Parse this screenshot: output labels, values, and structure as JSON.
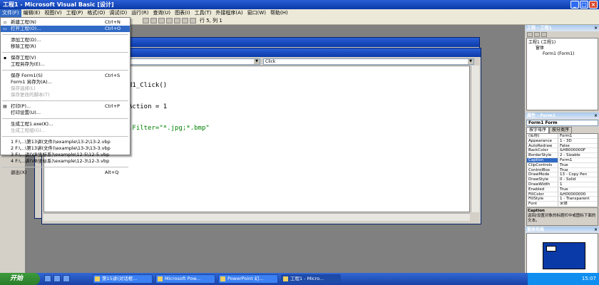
{
  "window": {
    "title": "工程1 - Microsoft Visual Basic [设计]",
    "min": "_",
    "max": "□",
    "close": "×"
  },
  "menubar": [
    "文件(F)",
    "编辑(E)",
    "视图(V)",
    "工程(P)",
    "格式(O)",
    "调试(D)",
    "运行(R)",
    "查询(U)",
    "图表(I)",
    "工具(T)",
    "外接程序(A)",
    "窗口(W)",
    "帮助(H)"
  ],
  "toolbar": {
    "position": "行 5, 列 1"
  },
  "file_menu": {
    "items": [
      {
        "label": "新建工程(N)",
        "shortcut": "Ctrl+N"
      },
      {
        "label": "打开工程(O)...",
        "shortcut": "Ctrl+O"
      },
      {
        "label": "添加工程(D)..."
      },
      {
        "label": "移除工程(R)"
      },
      {
        "label": "保存工程(V)"
      },
      {
        "label": "工程另存为(E)..."
      },
      {
        "label": "保存 Form1(S)",
        "shortcut": "Ctrl+S"
      },
      {
        "label": "Form1 另存为(A)..."
      },
      {
        "label": "保存选择(L)"
      },
      {
        "label": "保存更改的脚本(T)"
      },
      {
        "label": "打印(P)...",
        "shortcut": "Ctrl+P"
      },
      {
        "label": "打印设置(U)..."
      },
      {
        "label": "生成工程1.exe(K)..."
      },
      {
        "label": "生成工程组(G)..."
      },
      {
        "label": "1 F:\\...\\第13讲(文件)\\example\\13-2\\13-2.vbp"
      },
      {
        "label": "2 F:\\...\\第13讲(文件)\\example\\13-3\\13-3.vbp"
      },
      {
        "label": "3 F:\\...讲(VB坐标系)\\example\\12-5\\12-5.vbp"
      },
      {
        "label": "4 F:\\...讲(VB坐标系)\\example\\12-3\\12-3.vbp"
      },
      {
        "label": "退出(X)",
        "shortcut": "Alt+Q"
      }
    ]
  },
  "code_window": {
    "procedure_combo": "Click",
    "lines": [
      "d1_Click()",
      "Action = 1",
      ".Filter=\"*.jpg;*.bmp\""
    ]
  },
  "project_panel": {
    "title": "工程 - 工程1",
    "tree": [
      "工程1 (工程1)",
      "窗体",
      "Form1 (Form1)"
    ]
  },
  "properties_panel": {
    "title": "属性 - Form1",
    "object": "Form1 Form",
    "tabs": [
      "按字母序",
      "按分类序"
    ],
    "rows": [
      {
        "k": "(名称)",
        "v": "Form1"
      },
      {
        "k": "Appearance",
        "v": "1 - 3D"
      },
      {
        "k": "AutoRedraw",
        "v": "False"
      },
      {
        "k": "BackColor",
        "v": "&H8000000F"
      },
      {
        "k": "BorderStyle",
        "v": "2 - Sizable"
      },
      {
        "k": "Caption",
        "v": "Form1"
      },
      {
        "k": "ClipControls",
        "v": "True"
      },
      {
        "k": "ControlBox",
        "v": "True"
      },
      {
        "k": "DrawMode",
        "v": "13 - Copy Pen"
      },
      {
        "k": "DrawStyle",
        "v": "0 - Solid"
      },
      {
        "k": "DrawWidth",
        "v": "1"
      },
      {
        "k": "Enabled",
        "v": "True"
      },
      {
        "k": "FillColor",
        "v": "&H00000000"
      },
      {
        "k": "FillStyle",
        "v": "1 - Transparent"
      },
      {
        "k": "Font",
        "v": "宋体"
      }
    ],
    "desc_title": "Caption",
    "desc_text": "返回/设置对象的标题栏中或图标下面的文本。"
  },
  "layout_panel": {
    "title": "窗体布局"
  },
  "taskbar": {
    "start": "开始",
    "tasks": [
      "第15讲(对话框...",
      "Microsoft Pow...",
      "PowerPoint 幻...",
      "工程1 - Micro..."
    ],
    "clock": "15:07"
  }
}
